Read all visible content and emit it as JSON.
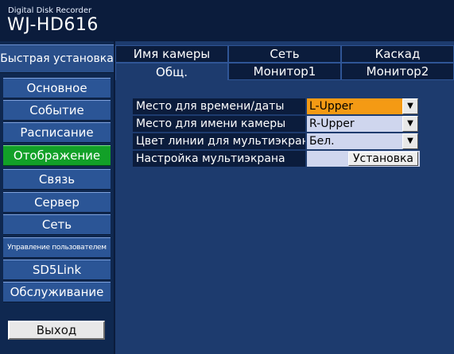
{
  "header": {
    "subtitle": "Digital Disk Recorder",
    "model": "WJ-HD616"
  },
  "sidebar": {
    "quick_setup": "Быстрая установка",
    "items": [
      {
        "label": "Основное",
        "active": false
      },
      {
        "label": "Событие",
        "active": false
      },
      {
        "label": "Расписание",
        "active": false
      },
      {
        "label": "Отображение",
        "active": true
      },
      {
        "label": "Связь",
        "active": false
      },
      {
        "label": "Сервер",
        "active": false
      },
      {
        "label": "Сеть",
        "active": false
      },
      {
        "label": "Управление пользователем",
        "active": false
      },
      {
        "label": "SD5Link",
        "active": false
      },
      {
        "label": "Обслуживание",
        "active": false
      }
    ],
    "exit_label": "Выход"
  },
  "tabs": {
    "row1": [
      "Имя камеры",
      "Сеть",
      "Каскад"
    ],
    "row2": [
      "Общ.",
      "Монитор1",
      "Монитор2"
    ],
    "active": "Общ."
  },
  "settings": [
    {
      "label": "Место для времени/даты",
      "value": "L-Upper",
      "highlight": true
    },
    {
      "label": "Место для имени камеры",
      "value": "R-Upper",
      "highlight": false
    },
    {
      "label": "Цвет линии для мультиэкрана",
      "value": "Бел.",
      "highlight": false
    },
    {
      "label": "Настройка мультиэкрана",
      "button": "Установка"
    }
  ],
  "colors": {
    "background": "#0b1c3c",
    "panel": "#1d3b6e",
    "menu_item": "#2b5596",
    "active_item": "#12a028",
    "highlight_value": "#f49a14"
  }
}
